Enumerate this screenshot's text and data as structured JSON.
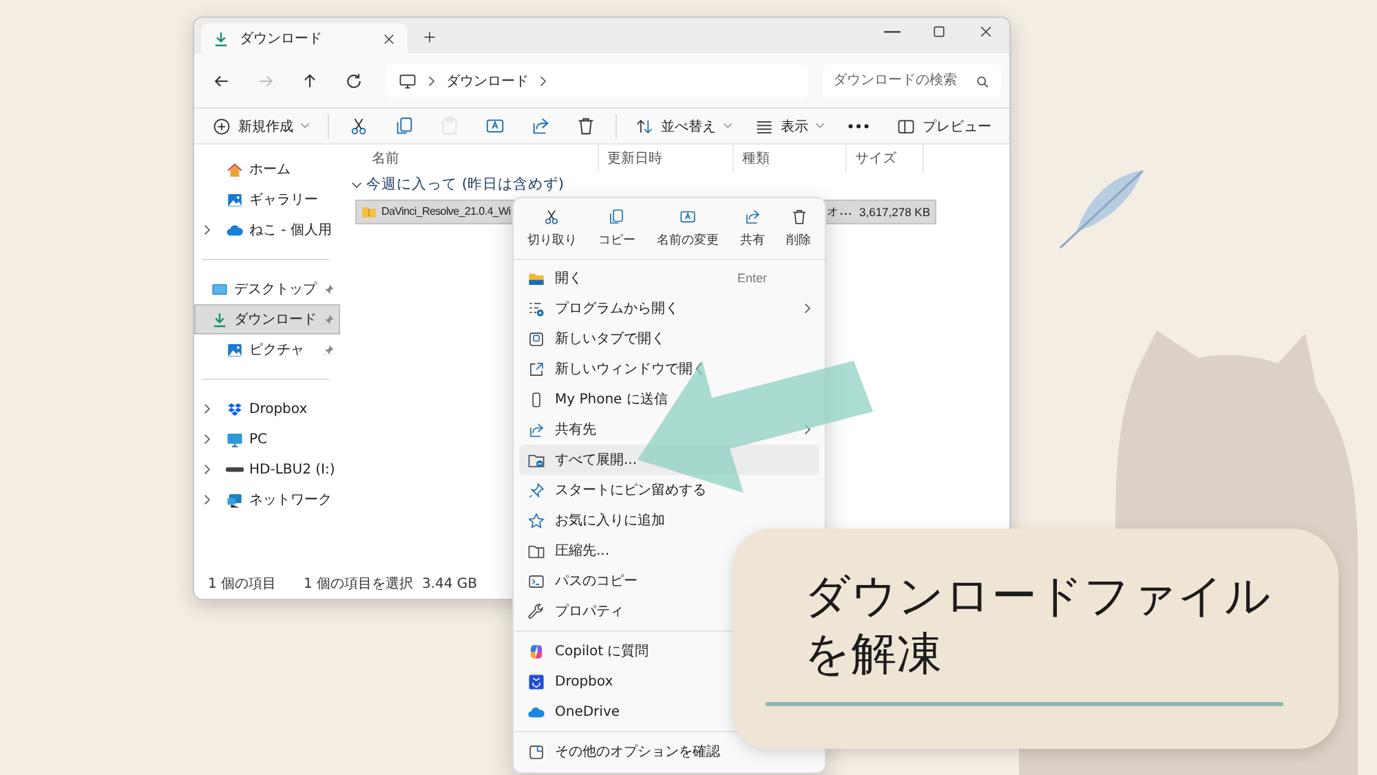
{
  "window": {
    "tab": {
      "title": "ダウンロード"
    },
    "nav_buttons": [
      {
        "disabled": false
      },
      {
        "disabled": true
      },
      {
        "disabled": false
      },
      {
        "disabled": false
      }
    ],
    "breadcrumb": [
      "ダウンロード"
    ],
    "search": {
      "placeholder": "ダウンロードの検索"
    },
    "toolbar": [
      {
        "kind": "menu",
        "label": "新規作成"
      },
      {
        "kind": "divider"
      },
      {
        "kind": "icon",
        "disabled": false
      },
      {
        "kind": "icon",
        "disabled": false
      },
      {
        "kind": "icon",
        "disabled": true
      },
      {
        "kind": "icon",
        "disabled": false
      },
      {
        "kind": "icon",
        "disabled": false
      },
      {
        "kind": "icon",
        "disabled": false
      },
      {
        "kind": "divider"
      },
      {
        "kind": "menu",
        "label": "並べ替え"
      },
      {
        "kind": "menu",
        "label": "表示"
      },
      {
        "kind": "icon",
        "disabled": false
      },
      {
        "kind": "spacer"
      },
      {
        "kind": "button",
        "label": "プレビュー"
      }
    ],
    "sidebar": {
      "sections": [
        [
          {
            "label": "ホーム",
            "expandable": false,
            "pinned": false,
            "selected": false
          },
          {
            "label": "ギャラリー",
            "expandable": false,
            "pinned": false,
            "selected": false
          },
          {
            "label": "ねこ - 個人用",
            "expandable": true,
            "pinned": false,
            "selected": false
          }
        ],
        [
          {
            "label": "デスクトップ",
            "expandable": false,
            "pinned": true,
            "selected": false
          },
          {
            "label": "ダウンロード",
            "expandable": false,
            "pinned": true,
            "selected": true
          },
          {
            "label": "ピクチャ",
            "expandable": false,
            "pinned": true,
            "selected": false
          }
        ],
        [
          {
            "label": "Dropbox",
            "expandable": true,
            "pinned": false,
            "selected": false
          },
          {
            "label": "PC",
            "expandable": true,
            "pinned": false,
            "selected": false
          },
          {
            "label": "HD-LBU2 (I:)",
            "expandable": true,
            "pinned": false,
            "selected": false
          },
          {
            "label": "ネットワーク",
            "expandable": true,
            "pinned": false,
            "selected": false
          }
        ]
      ]
    },
    "columns": [
      "名前",
      "更新日時",
      "種類",
      "サイズ"
    ],
    "group": {
      "label": "今週に入って (昨日は含めず)",
      "expanded": true
    },
    "files": [
      {
        "name": "DaVinci_Resolve_21.0.4_Wi",
        "type": "ォ...",
        "size": "3,617,278 KB",
        "selected": true
      }
    ],
    "status_bar": [
      "1 個の項目",
      "1 個の項目を選択  3.44 GB"
    ]
  },
  "context_menu": {
    "quick_actions": [
      {
        "label": "切り取り"
      },
      {
        "label": "コピー"
      },
      {
        "label": "名前の変更"
      },
      {
        "label": "共有"
      },
      {
        "label": "削除"
      }
    ],
    "groups": [
      [
        {
          "label": "開く",
          "shortcut": "Enter",
          "submenu": false,
          "selected": false
        },
        {
          "label": "プログラムから開く",
          "submenu": true,
          "selected": false
        },
        {
          "label": "新しいタブで開く",
          "submenu": false,
          "selected": false
        },
        {
          "label": "新しいウィンドウで開く",
          "submenu": false,
          "selected": false
        },
        {
          "label": "My Phone に送信",
          "submenu": false,
          "selected": false
        },
        {
          "label": "共有先",
          "submenu": true,
          "selected": false
        },
        {
          "label": "すべて展開...",
          "submenu": false,
          "selected": true
        },
        {
          "label": "スタートにピン留めする",
          "submenu": false,
          "selected": false
        },
        {
          "label": "お気に入りに追加",
          "submenu": false,
          "selected": false
        },
        {
          "label": "圧縮先...",
          "selected": false
        },
        {
          "label": "パスのコピー",
          "selected": false
        },
        {
          "label": "プロパティ",
          "selected": false
        }
      ],
      [
        {
          "label": "Copilot に質問",
          "selected": false
        },
        {
          "label": "Dropbox",
          "selected": false
        },
        {
          "label": "OneDrive",
          "selected": false
        }
      ],
      [
        {
          "label": "その他のオプションを確認",
          "submenu": false,
          "selected": false
        }
      ]
    ]
  },
  "caption": {
    "lines": [
      "ダウンロードファイル",
      "を解凍"
    ]
  }
}
